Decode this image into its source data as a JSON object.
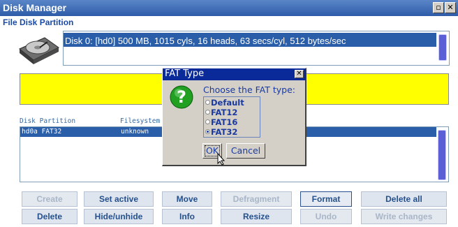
{
  "window": {
    "title": "Disk Manager",
    "subtitle": "File Disk Partition"
  },
  "disk": {
    "icon": "hard-disk-icon",
    "info": "Disk 0: [hd0] 500 MB, 1015 cyls, 16 heads, 63 secs/cyl, 512 bytes/sec"
  },
  "partitions": {
    "headers": [
      "Disk Partition",
      "Filesystem"
    ],
    "rows": [
      {
        "partition": "hd0a FAT32",
        "filesystem": "unknown"
      }
    ]
  },
  "buttons": {
    "create": "Create",
    "set_active": "Set active",
    "move": "Move",
    "defragment": "Defragment",
    "format": "Format",
    "delete_all": "Delete all",
    "delete": "Delete",
    "hide_unhide": "Hide/unhide",
    "info": "Info",
    "resize": "Resize",
    "undo": "Undo",
    "write_changes": "Write changes"
  },
  "dialog": {
    "title": "FAT Type",
    "prompt": "Choose the FAT type:",
    "icon": "question-icon",
    "options": [
      "Default",
      "FAT12",
      "FAT16",
      "FAT32"
    ],
    "selected": "FAT32",
    "ok": "OK",
    "cancel": "Cancel"
  },
  "colors": {
    "title_bar": "#2e5ba8",
    "selection": "#2a5ea9",
    "highlight_area": "#ffff00",
    "dialog_title": "#0a2a9a"
  }
}
